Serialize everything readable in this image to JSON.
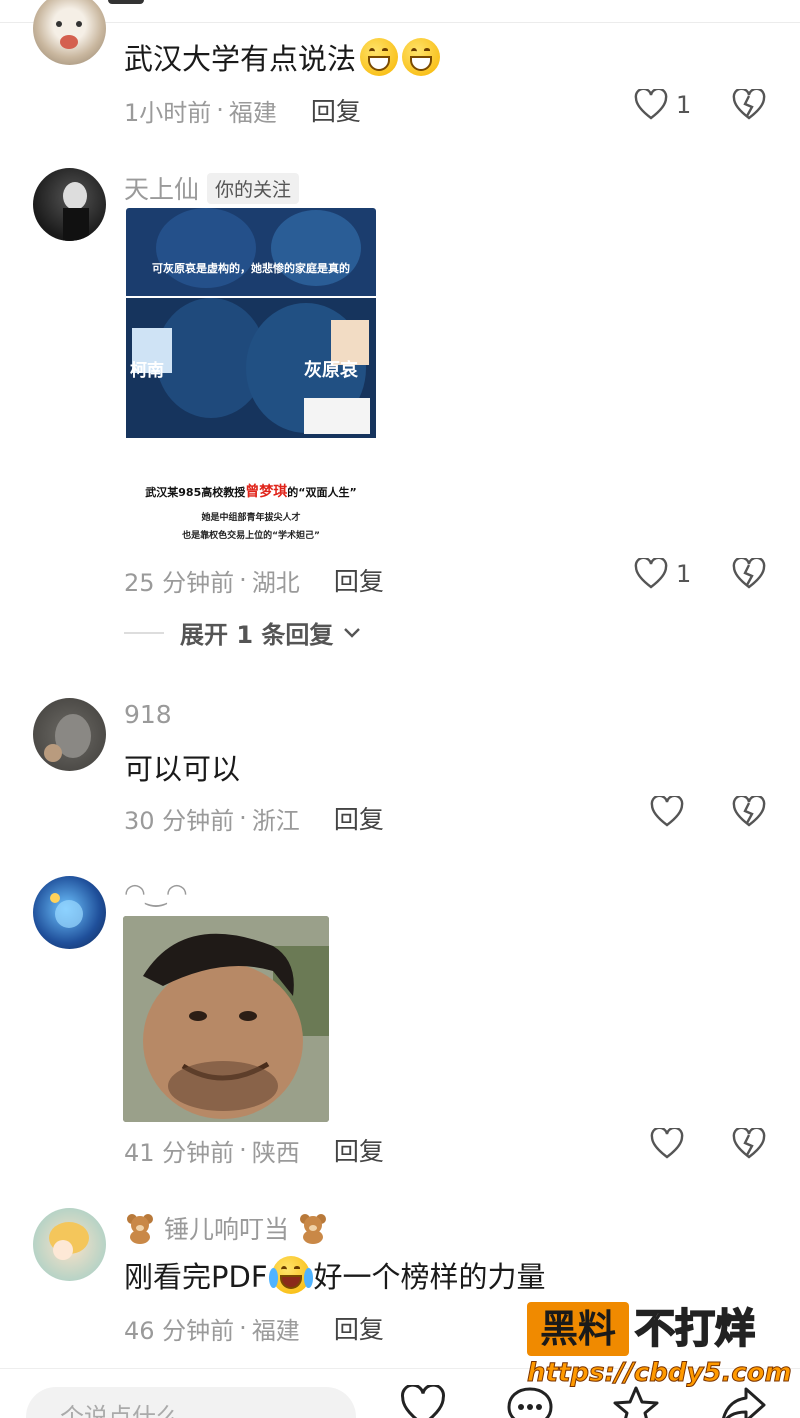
{
  "comments": [
    {
      "username": "",
      "text": "武汉大学有点说法",
      "time": "1小时前",
      "location": "福建",
      "reply_label": "回复",
      "likes": "1"
    },
    {
      "username": "天上仙",
      "follow_tag": "你的关注",
      "time": "25 分钟前",
      "location": "湖北",
      "reply_label": "回复",
      "likes": "1",
      "image": {
        "banner1": "可灰原哀是虚构的，她悲惨的家庭是真的",
        "label_left": "柯南",
        "label_right": "灰原哀",
        "headline_prefix": "武汉某985高校教授",
        "headline_name": "曾梦琪",
        "headline_suffix": "的“双面人生”",
        "line2": "她是中组部青年拔尖人才",
        "line3": "也是靠权色交易上位的“学术妲己”"
      },
      "expand_label": "展开 1 条回复"
    },
    {
      "username": "918",
      "text": "可以可以",
      "time": "30 分钟前",
      "location": "浙江",
      "reply_label": "回复"
    },
    {
      "username": "◠‿◠",
      "time": "41 分钟前",
      "location": "陕西",
      "reply_label": "回复"
    },
    {
      "username_prefix_icon": "teddy-bear-emoji",
      "username": "锤儿响叮当",
      "text_before": "刚看完PDF",
      "text_after": "好一个榜样的力量",
      "time": "46 分钟前",
      "location": "福建",
      "reply_label": "回复"
    }
  ],
  "meta_separator": "·",
  "input": {
    "placeholder": "个说点什么"
  },
  "watermark": {
    "box_text": "黑料",
    "word": "不打烊",
    "url": "https://cbdy5.com"
  },
  "icons": [
    "heart-icon",
    "broken-heart-icon",
    "chevron-down-icon",
    "comment-icon",
    "star-icon",
    "share-icon"
  ],
  "colors": {
    "accent_orange": "#f08a00",
    "meta_gray": "#9a9a9a",
    "text": "#1a1a1a"
  }
}
